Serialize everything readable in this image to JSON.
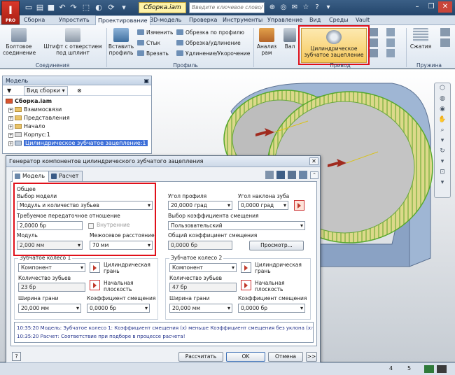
{
  "app": {
    "logo_letter": "I",
    "logo_sub": "PRO"
  },
  "titlebar": {
    "document_title": "Сборка.iam",
    "search_placeholder": "Введите ключевое слово/фразу"
  },
  "ribbon_tabs": [
    "Сборка",
    "Упростить",
    "Проектирование",
    "3D-модель",
    "Проверка",
    "Инструменты",
    "Управление",
    "Вид",
    "Среды",
    "Vault"
  ],
  "ribbon_active_tab": "Проектирование",
  "ribbon": {
    "bolt_label": "Болтовое соединение",
    "pin_label": "Штифт с отверстием под шплинт",
    "insert_profile": "Вставить профиль",
    "change": "Изменить",
    "joint": "Стык",
    "notch": "Врезать",
    "trim_profile": "Обрезка по профилю",
    "trim_extend": "Обрезка/удлинение",
    "lengthen": "Удлинение/Укорочение",
    "analysis": "Анализ рам",
    "shaft": "Вал",
    "spur_gear": "Цилиндрическое зубчатое зацепление",
    "compression": "Сжатия",
    "group_connections": "Соединения",
    "group_profile": "Профиль",
    "group_drive": "Привод",
    "group_spring": "Пружина"
  },
  "browser": {
    "title": "Модель",
    "view_mode": "Вид сборки",
    "items": [
      "Сборка.iam",
      "Взаимосвязи",
      "Представления",
      "Начало",
      "Корпус:1",
      "Цилиндрическое зубчатое зацепление:1"
    ]
  },
  "dialog": {
    "title": "Генератор компонентов цилиндрического зубчатого зацепления",
    "tab_model": "Модель",
    "tab_calc": "Расчет",
    "general": "Общее",
    "model_choice_label": "Выбор модели",
    "model_choice_value": "Модуль и количество зубьев",
    "ratio_label": "Требуемое передаточное отношение",
    "ratio_value": "2,0000 бр",
    "internal_label": "Внутренние",
    "module_label": "Модуль",
    "module_value": "2,000 мм",
    "center_label": "Межосевое расстояние",
    "center_value": "70 мм",
    "pressure_label": "Угол профиля",
    "pressure_value": "20,0000 град",
    "helix_label": "Угол наклона зуба",
    "helix_value": "0,0000 град",
    "shift_choice_label": "Выбор коэффициента смещения",
    "shift_choice_value": "Пользовательский",
    "total_shift_label": "Общий коэффициент смещения",
    "total_shift_value": "0,0000 бр",
    "preview_button": "Просмотр...",
    "gear1": {
      "title": "Зубчатое колесо 1",
      "type": "Компонент",
      "cyl_face": "Цилиндрическая грань",
      "teeth_label": "Количество зубьев",
      "teeth_value": "23 бр",
      "start_plane": "Начальная плоскость",
      "width_label": "Ширина грани",
      "width_value": "20,000 мм",
      "shift_label": "Коэффициент смещения",
      "shift_value": "0,0000 бр"
    },
    "gear2": {
      "title": "Зубчатое колесо 2",
      "type": "Компонент",
      "cyl_face": "Цилиндрическая грань",
      "teeth_label": "Количество зубьев",
      "teeth_value": "47 бр",
      "start_plane": "Начальная плоскость",
      "width_label": "Ширина грани",
      "width_value": "20,000 мм",
      "shift_label": "Коэффициент смещения",
      "shift_value": "0,0000 бр"
    },
    "messages": [
      "10:35:20 Модель: Зубчатое колесо 1: Коэффициент смещения (x) меньше Коэффициент смещения без уклона (x₇)",
      "10:35:20 Расчет: Соответствие при подборе в процессе расчета!"
    ],
    "calc_button": "Рассчитать",
    "ok_button": "OK",
    "cancel_button": "Отмена",
    "more_button": ">>"
  },
  "status": {
    "num1": "4",
    "num2": "5"
  },
  "colors": {
    "highlight_red": "#e0101a",
    "gear_gray": "#bfbfbf",
    "housing_blue": "#9cb4d3"
  }
}
